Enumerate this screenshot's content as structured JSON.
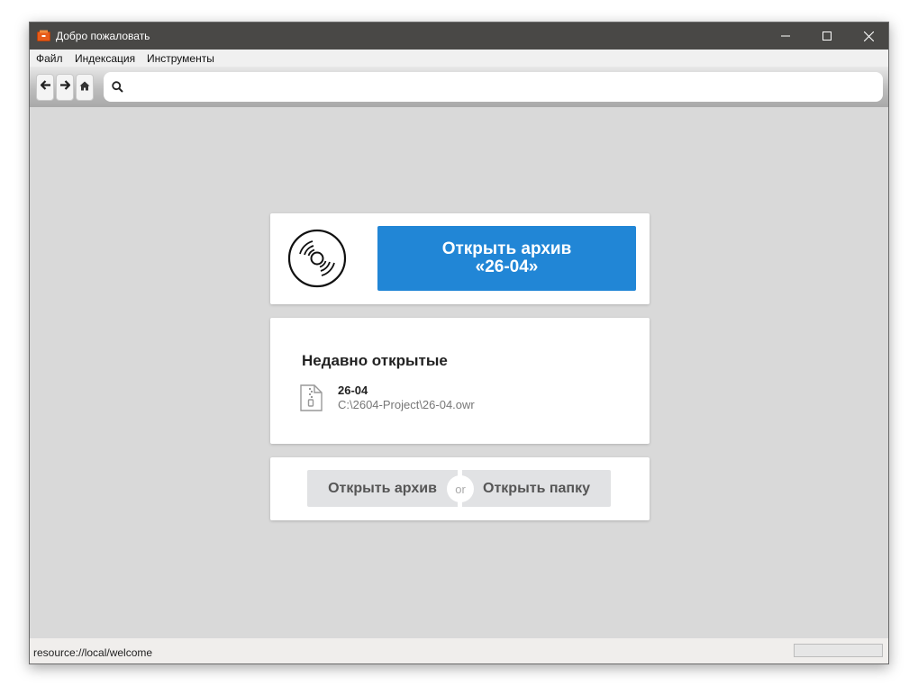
{
  "window": {
    "title": "Добро пожаловать",
    "icons": {
      "app": "archive-box-icon",
      "minimize": "minimize-icon",
      "maximize": "maximize-icon",
      "close": "close-icon"
    }
  },
  "menu": {
    "items": [
      {
        "label": "Файл"
      },
      {
        "label": "Индексация"
      },
      {
        "label": "Инструменты"
      }
    ]
  },
  "toolbar": {
    "icons": {
      "back": "arrow-left-icon",
      "forward": "arrow-right-icon",
      "home": "home-icon",
      "search": "search-icon"
    },
    "search": {
      "value": "",
      "placeholder": ""
    }
  },
  "main": {
    "open_card": {
      "icon": "disc-icon",
      "button_line1": "Открыть архив",
      "button_line2": "«26-04»",
      "button_color": "#2186d6"
    },
    "recent": {
      "title": "Недавно открытые",
      "items": [
        {
          "name": "26-04",
          "path": "C:\\2604-Project\\26-04.owr",
          "icon": "zip-file-icon"
        }
      ]
    },
    "actions": {
      "open_archive": "Открыть архив",
      "or": "or",
      "open_folder": "Открыть папку"
    }
  },
  "status": {
    "text": "resource://local/welcome",
    "progress": 0
  }
}
